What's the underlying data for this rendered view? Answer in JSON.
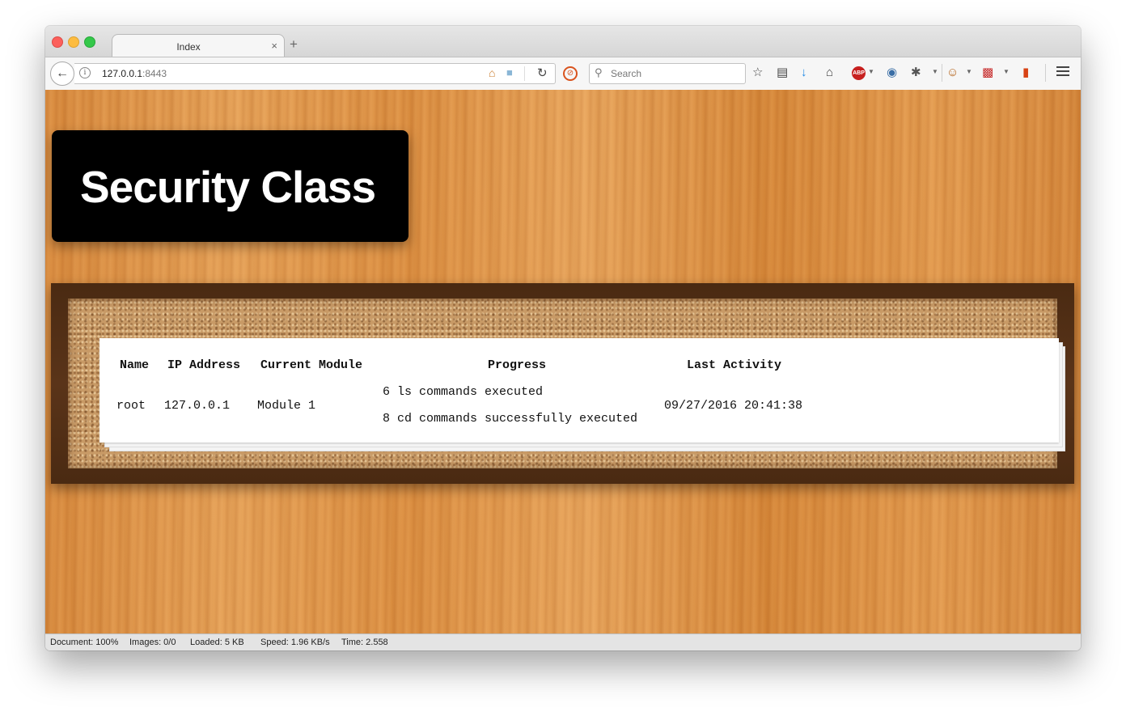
{
  "browser": {
    "tab_title": "Index",
    "tab_close": "×",
    "new_tab": "+",
    "url_host": "127.0.0.1",
    "url_port": ":8443",
    "search_placeholder": "Search",
    "icons": [
      "back-icon",
      "info-icon",
      "home-icon",
      "extension-icon",
      "reload-icon",
      "block-icon",
      "search-icon",
      "star-icon",
      "reading-list-icon",
      "download-icon",
      "home-icon",
      "abp-icon",
      "globe-icon",
      "bug-icon",
      "monkey-icon",
      "news-icon",
      "lamp-icon",
      "menu-icon"
    ]
  },
  "page": {
    "title": "Security Class",
    "table": {
      "headers": [
        "Name",
        "IP Address",
        "Current Module",
        "Progress",
        "Last Activity"
      ],
      "rows": [
        {
          "name": "root",
          "ip": "127.0.0.1",
          "module": "Module 1",
          "progress": [
            "6 ls commands executed",
            "8 cd commands successfully executed"
          ],
          "last_activity": "09/27/2016 20:41:38"
        }
      ]
    }
  },
  "status_bar": {
    "document": "Document: 100%",
    "images": "Images: 0/0",
    "loaded": "Loaded: 5 KB",
    "speed": "Speed: 1.96 KB/s",
    "time": "Time: 2.558"
  },
  "colors": {
    "title_bg": "#000000",
    "frame": "#4a2a12",
    "wood": "#e09a4e"
  }
}
